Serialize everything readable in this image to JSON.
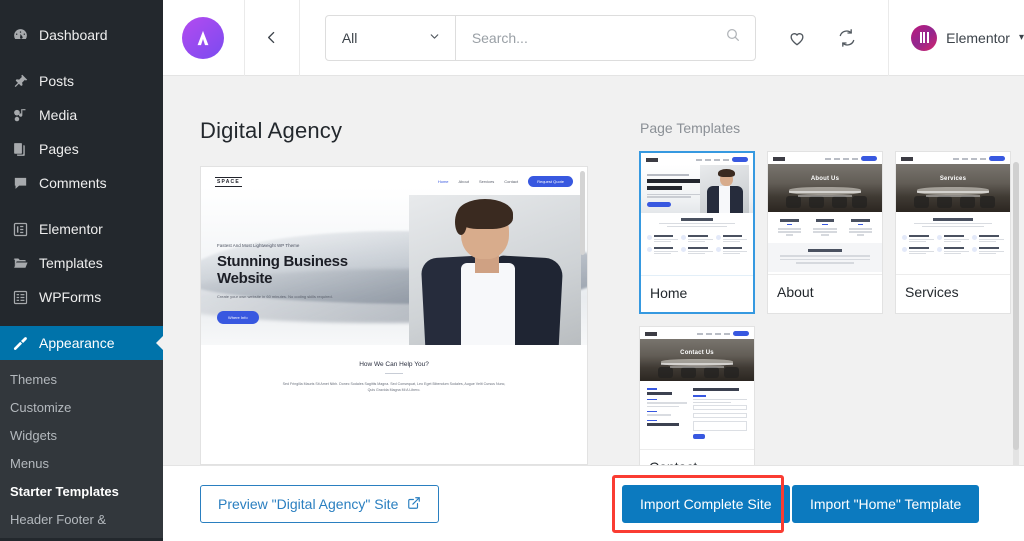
{
  "sidebar": {
    "items": [
      {
        "label": "Dashboard",
        "icon": "dashboard-icon"
      },
      {
        "label": "Posts",
        "icon": "pin-icon"
      },
      {
        "label": "Media",
        "icon": "media-icon"
      },
      {
        "label": "Pages",
        "icon": "pages-icon"
      },
      {
        "label": "Comments",
        "icon": "comment-icon"
      },
      {
        "label": "Elementor",
        "icon": "elementor-icon"
      },
      {
        "label": "Templates",
        "icon": "folder-icon"
      },
      {
        "label": "WPForms",
        "icon": "form-icon"
      },
      {
        "label": "Appearance",
        "icon": "brush-icon"
      }
    ],
    "submenu": [
      {
        "label": "Themes"
      },
      {
        "label": "Customize"
      },
      {
        "label": "Widgets"
      },
      {
        "label": "Menus"
      },
      {
        "label": "Starter Templates"
      },
      {
        "label": "Header Footer &"
      }
    ]
  },
  "topbar": {
    "logo_alt": "astra-logo",
    "back_label": "back",
    "filter": {
      "value": "All",
      "caret": "chevron-down-icon"
    },
    "search": {
      "placeholder": "Search...",
      "value": ""
    },
    "favorites_label": "favorites",
    "sync_label": "sync",
    "user": {
      "name": "Elementor",
      "caret": "▾"
    }
  },
  "content": {
    "page_title": "Digital Agency",
    "section_label": "Page Templates",
    "preview": {
      "logo": "SPACE",
      "nav": [
        "Home",
        "About",
        "Services",
        "Contact"
      ],
      "cta": "Request Quote",
      "kicker": "Fastest And Most Lightweight WP Theme",
      "headline": "Stunning Business Website",
      "subtext": "Create your own website in 60 minutes. No coding skills required.",
      "hero_button": "Where Info",
      "section_heading": "How We Can Help You?",
      "section_text": "Sed Fringilla Mauris Sit Amet Nibh. Donec Sodales Sagittis Magna. Sed Consequat, Leo Eget Bibendum Sodales, Augue Velit Cursus Nunc, Quis Gravida Magna Mi A Libero."
    },
    "templates": [
      {
        "label": "Home",
        "selected": true,
        "banner_title": "Stunning Business Website"
      },
      {
        "label": "About",
        "selected": false,
        "banner_title": "About Us"
      },
      {
        "label": "Services",
        "selected": false,
        "banner_title": "Services"
      },
      {
        "label": "Contact",
        "selected": false,
        "banner_title": "Contact Us"
      }
    ]
  },
  "footer": {
    "preview_button": "Preview \"Digital Agency\" Site",
    "preview_icon": "external-link-icon",
    "import_site_button": "Import Complete Site",
    "import_template_button": "Import \"Home\" Template"
  },
  "colors": {
    "sidebar_bg": "#23282d",
    "sidebar_submenu_bg": "#32373c",
    "sidebar_active": "#0073aa",
    "primary_button": "#0c7abf",
    "link_blue": "#2a7fc0",
    "selection_border": "#3699e0",
    "annotation_red": "#fa3c32",
    "page_bg": "#f1f1f1"
  }
}
